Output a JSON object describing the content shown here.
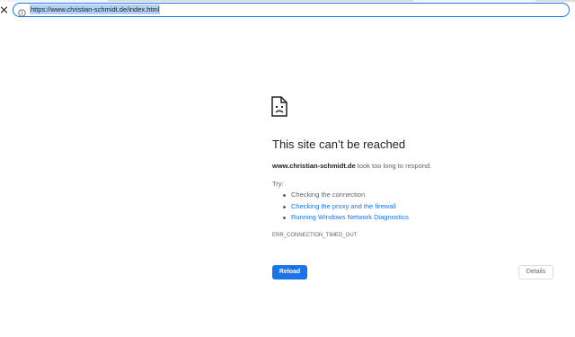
{
  "browser": {
    "url": "https://www.christian-schmidt.de/index.html",
    "accent_color": "#1a73e8",
    "icons": {
      "close": "close-icon",
      "site_info": "info-icon"
    }
  },
  "error_page": {
    "icon": "sad-document-icon",
    "title": "This site can’t be reached",
    "host": "www.christian-schmidt.de",
    "message": " took too long to respond.",
    "try_label": "Try:",
    "suggestions": [
      {
        "text": "Checking the connection",
        "is_link": false
      },
      {
        "text": "Checking the proxy and the firewall",
        "is_link": true
      },
      {
        "text": "Running Windows Network Diagnostics",
        "is_link": true
      }
    ],
    "error_code": "ERR_CONNECTION_TIMED_OUT",
    "reload_label": "Reload",
    "details_label": "Details"
  }
}
